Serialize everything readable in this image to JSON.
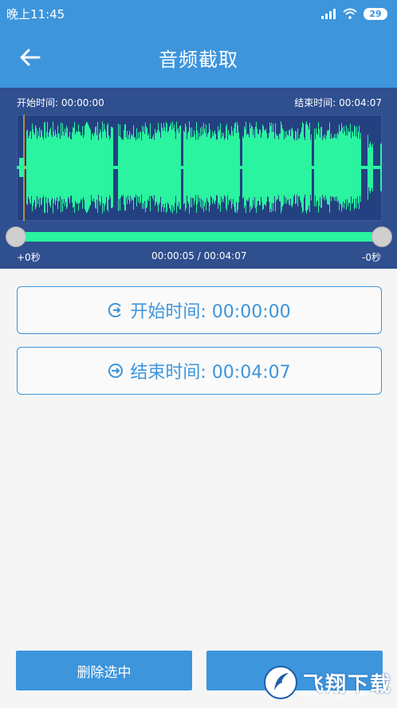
{
  "status": {
    "time": "晚上11:45",
    "battery": "29"
  },
  "header": {
    "title": "音频截取"
  },
  "waveform": {
    "start_label": "开始时间: 00:00:00",
    "end_label": "结束时间: 00:04:07",
    "left_offset": "+0秒",
    "position": "00:00:05 / 00:04:07",
    "right_offset": "-0秒",
    "progress": 0.02
  },
  "buttons": {
    "start_time": "开始时间: 00:00:00",
    "end_time": "结束时间: 00:04:07",
    "delete_selected": "删除选中",
    "watermark": "飞翔下载",
    "watermark_url": "www.FIXXZ.COM"
  },
  "colors": {
    "accent": "#3d95dc",
    "panel": "#2f4f8f",
    "wave": "#2af4a0"
  }
}
